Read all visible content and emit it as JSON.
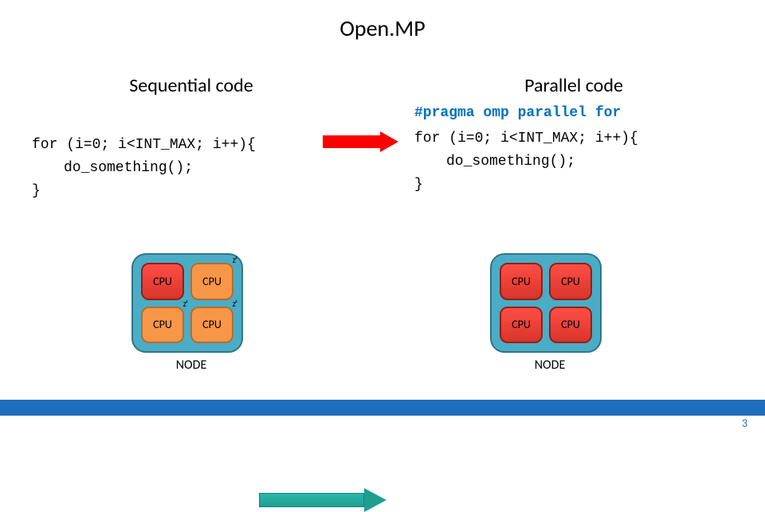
{
  "title": "Open.MP",
  "left": {
    "heading": "Sequential code",
    "code1": "for (i=0; i<INT_MAX; i++){",
    "code2": "do_something();",
    "code3": "}"
  },
  "right": {
    "heading": "Parallel code",
    "pragma": "#pragma omp parallel for",
    "code1": "for (i=0; i<INT_MAX; i++){",
    "code2": "do_something();",
    "code3": "}"
  },
  "cpu_label": "CPU",
  "node_label": "NODE",
  "sleep": "zᶻ",
  "page": "3"
}
